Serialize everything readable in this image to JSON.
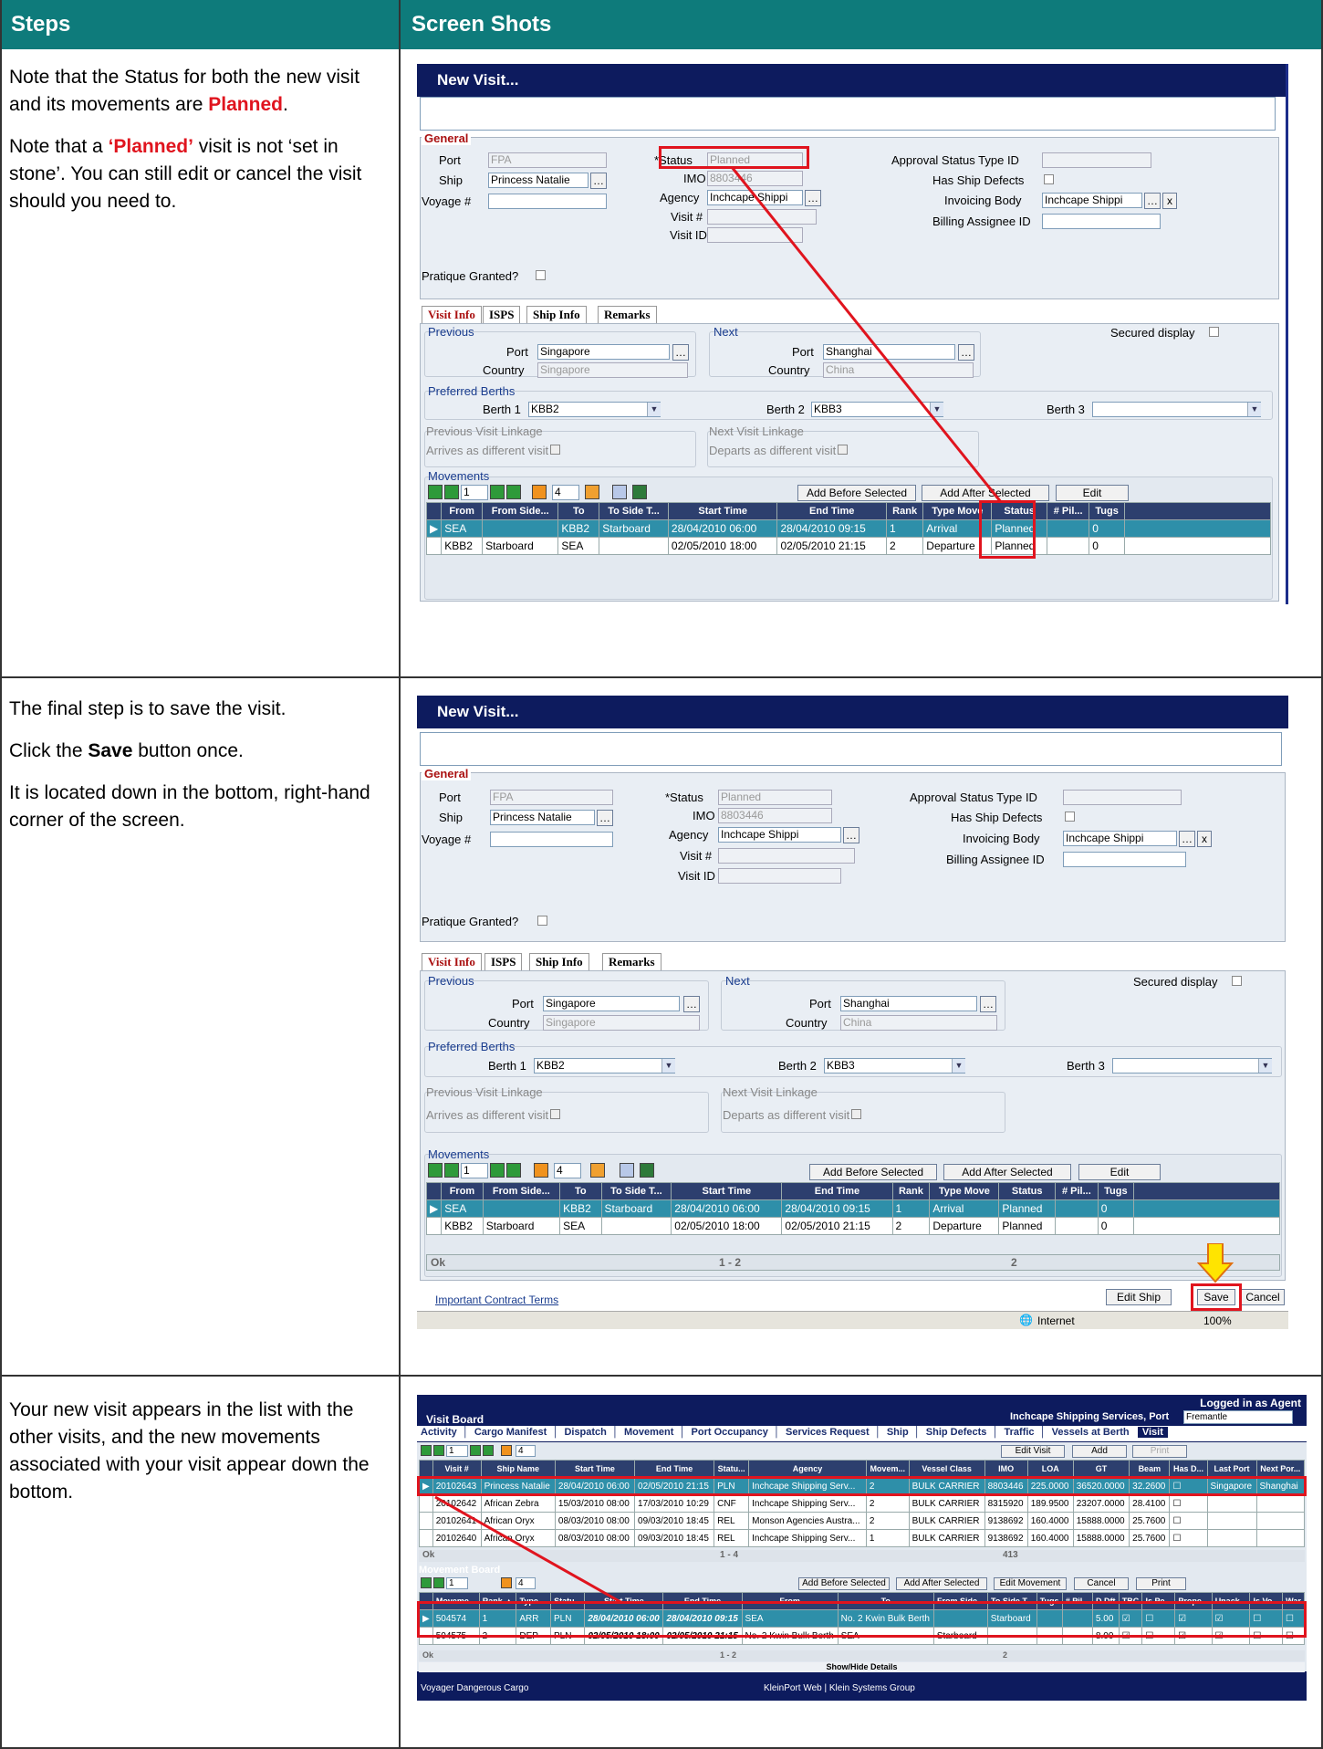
{
  "header": {
    "steps": "Steps",
    "screenshots": "Screen Shots"
  },
  "steps": [
    {
      "p1a": "Note that the Status for both the new visit and its movements are ",
      "p1b": "Planned",
      "p1c": ".",
      "p2a": "Note that a ",
      "p2b": "‘Planned’",
      "p2c": " visit is not ‘set in stone’.  You can still edit or cancel the visit should you need to."
    },
    {
      "p1": "The final step is to save the visit.",
      "p2a": "Click the ",
      "p2b": "Save",
      "p2c": " button once.",
      "p3": "It is located down in the bottom, right-hand corner of the screen."
    },
    {
      "p1": "Your new visit appears in the list with the other visits, and the new movements associated with your visit appear down the bottom."
    }
  ],
  "visit": {
    "title": "New Visit...",
    "general": "General",
    "port_label": "Port",
    "port": "FPA",
    "ship_label": "Ship",
    "ship": "Princess Natalie",
    "voyage_label": "Voyage #",
    "status_label": "*Status",
    "status": "Planned",
    "imo_label": "IMO",
    "imo": "8803446",
    "agency_label": "Agency",
    "agency": "Inchcape Shippi",
    "visitno_label": "Visit #",
    "visitid_label": "Visit ID",
    "approval_label": "Approval Status Type ID",
    "defects_label": "Has Ship Defects",
    "invoicing_label": "Invoicing Body",
    "invoicing": "Inchcape Shippi",
    "billing_label": "Billing Assignee ID",
    "pratique_label": "Pratique Granted?",
    "tabs": [
      "Visit Info",
      "ISPS",
      "Ship Info",
      "Remarks"
    ],
    "previous": "Previous",
    "next": "Next",
    "secured": "Secured display",
    "port_lbl": "Port",
    "country_lbl": "Country",
    "prev_port": "Singapore",
    "prev_country": "Singapore",
    "next_port": "Shanghai",
    "next_country": "China",
    "pref_berths": "Preferred Berths",
    "berth1_label": "Berth 1",
    "berth1": "KBB2",
    "berth2_label": "Berth 2",
    "berth2": "KBB3",
    "berth3_label": "Berth 3",
    "prev_link": "Previous Visit Linkage",
    "arrives": "Arrives as different visit",
    "next_link": "Next Visit Linkage",
    "departs": "Departs as different visit",
    "movements": "Movements",
    "page": "1",
    "count": "4",
    "add_before": "Add Before Selected",
    "add_after": "Add After Selected",
    "edit": "Edit",
    "cols": [
      "From",
      "From Side...",
      "To",
      "To Side T...",
      "Start Time",
      "End Time",
      "Rank",
      "Type Move",
      "Status",
      "# Pil...",
      "Tugs"
    ],
    "rows": [
      [
        "SEA",
        "",
        "KBB2",
        "Starboard",
        "28/04/2010 06:00",
        "28/04/2010 09:15",
        "1",
        "Arrival",
        "Planned",
        "",
        "0"
      ],
      [
        "KBB2",
        "Starboard",
        "SEA",
        "",
        "02/05/2010 18:00",
        "02/05/2010 21:15",
        "2",
        "Departure",
        "Planned",
        "",
        "0"
      ]
    ],
    "ok": "Ok",
    "range": "1 - 2",
    "pages": "2",
    "contract": "Important Contract Terms",
    "editship": "Edit Ship",
    "save": "Save",
    "cancel": "Cancel",
    "internet": "Internet",
    "zoom": "100%"
  },
  "board": {
    "title": "Visit Board",
    "logged": "Logged in as Agent",
    "company": "Inchcape Shipping Services, Port",
    "port": "Fremantle",
    "tabs": [
      "Activity",
      "Cargo Manifest",
      "Dispatch",
      "Movement",
      "Port Occupancy",
      "Services Request",
      "Ship",
      "Ship Defects",
      "Traffic",
      "Vessels at Berth",
      "Visit"
    ],
    "page": "1",
    "count": "4",
    "editvisit": "Edit Visit",
    "add": "Add",
    "print": "Print",
    "cols": [
      "Visit #",
      "Ship Name",
      "Start Time",
      "End Time",
      "Statu...",
      "Agency",
      "Movem...",
      "Vessel Class",
      "IMO",
      "LOA",
      "GT",
      "Beam",
      "Has D...",
      "Last Port",
      "Next Por..."
    ],
    "rows": [
      [
        "20102643",
        "Princess Natalie",
        "28/04/2010 06:00",
        "02/05/2010 21:15",
        "PLN",
        "Inchcape Shipping Serv...",
        "2",
        "BULK CARRIER",
        "8803446",
        "225.0000",
        "36520.0000",
        "32.2600",
        "",
        "Singapore",
        "Shanghai"
      ],
      [
        "20102642",
        "African Zebra",
        "15/03/2010 08:00",
        "17/03/2010 10:29",
        "CNF",
        "Inchcape Shipping Serv...",
        "2",
        "BULK CARRIER",
        "8315920",
        "189.9500",
        "23207.0000",
        "28.4100",
        "",
        "",
        ""
      ],
      [
        "20102641",
        "African Oryx",
        "08/03/2010 08:00",
        "09/03/2010 18:45",
        "REL",
        "Monson Agencies Austra...",
        "2",
        "BULK CARRIER",
        "9138692",
        "160.4000",
        "15888.0000",
        "25.7600",
        "",
        "",
        ""
      ],
      [
        "20102640",
        "African Oryx",
        "08/03/2010 08:00",
        "09/03/2010 18:45",
        "REL",
        "Inchcape Shipping Serv...",
        "1",
        "BULK CARRIER",
        "9138692",
        "160.4000",
        "15888.0000",
        "25.7600",
        "",
        "",
        ""
      ]
    ],
    "ok": "Ok",
    "range": "1 - 4",
    "total": "413",
    "mtitle": "Movement Board",
    "addbefore": "Add Before Selected",
    "addafter": "Add After Selected",
    "editmove": "Edit Movement",
    "mcancel": "Cancel",
    "mprint": "Print",
    "mcols": [
      "Moveme...",
      "Rank ▲",
      "Type ...",
      "Statu...",
      "Start Time",
      "End Time",
      "From",
      "To",
      "From Side...",
      "To Side T...",
      "Tugs",
      "# Pil...",
      "D Dft",
      "TBC",
      "Is Pe...",
      "Prope...",
      "Unack...",
      "Is Vo...",
      "War"
    ],
    "mrows": [
      [
        "504574",
        "1",
        "ARR",
        "PLN",
        "28/04/2010 06:00",
        "28/04/2010 09:15",
        "SEA",
        "No. 2 Kwin Bulk Berth",
        "",
        "Starboard",
        "",
        "",
        "5.00"
      ],
      [
        "504575",
        "2",
        "DEP",
        "PLN",
        "02/05/2010 18:00",
        "02/05/2010 21:15",
        "No. 2 Kwin Bulk Berth",
        "SEA",
        "Starboard",
        "",
        "",
        "",
        "8.00"
      ]
    ],
    "mok": "Ok",
    "mrange": "1 - 2",
    "mpages": "2",
    "showhide": "Show/Hide Details",
    "footer_left": "Voyager Dangerous Cargo",
    "footer_mid": "KleinPort Web | Klein Systems Group"
  }
}
